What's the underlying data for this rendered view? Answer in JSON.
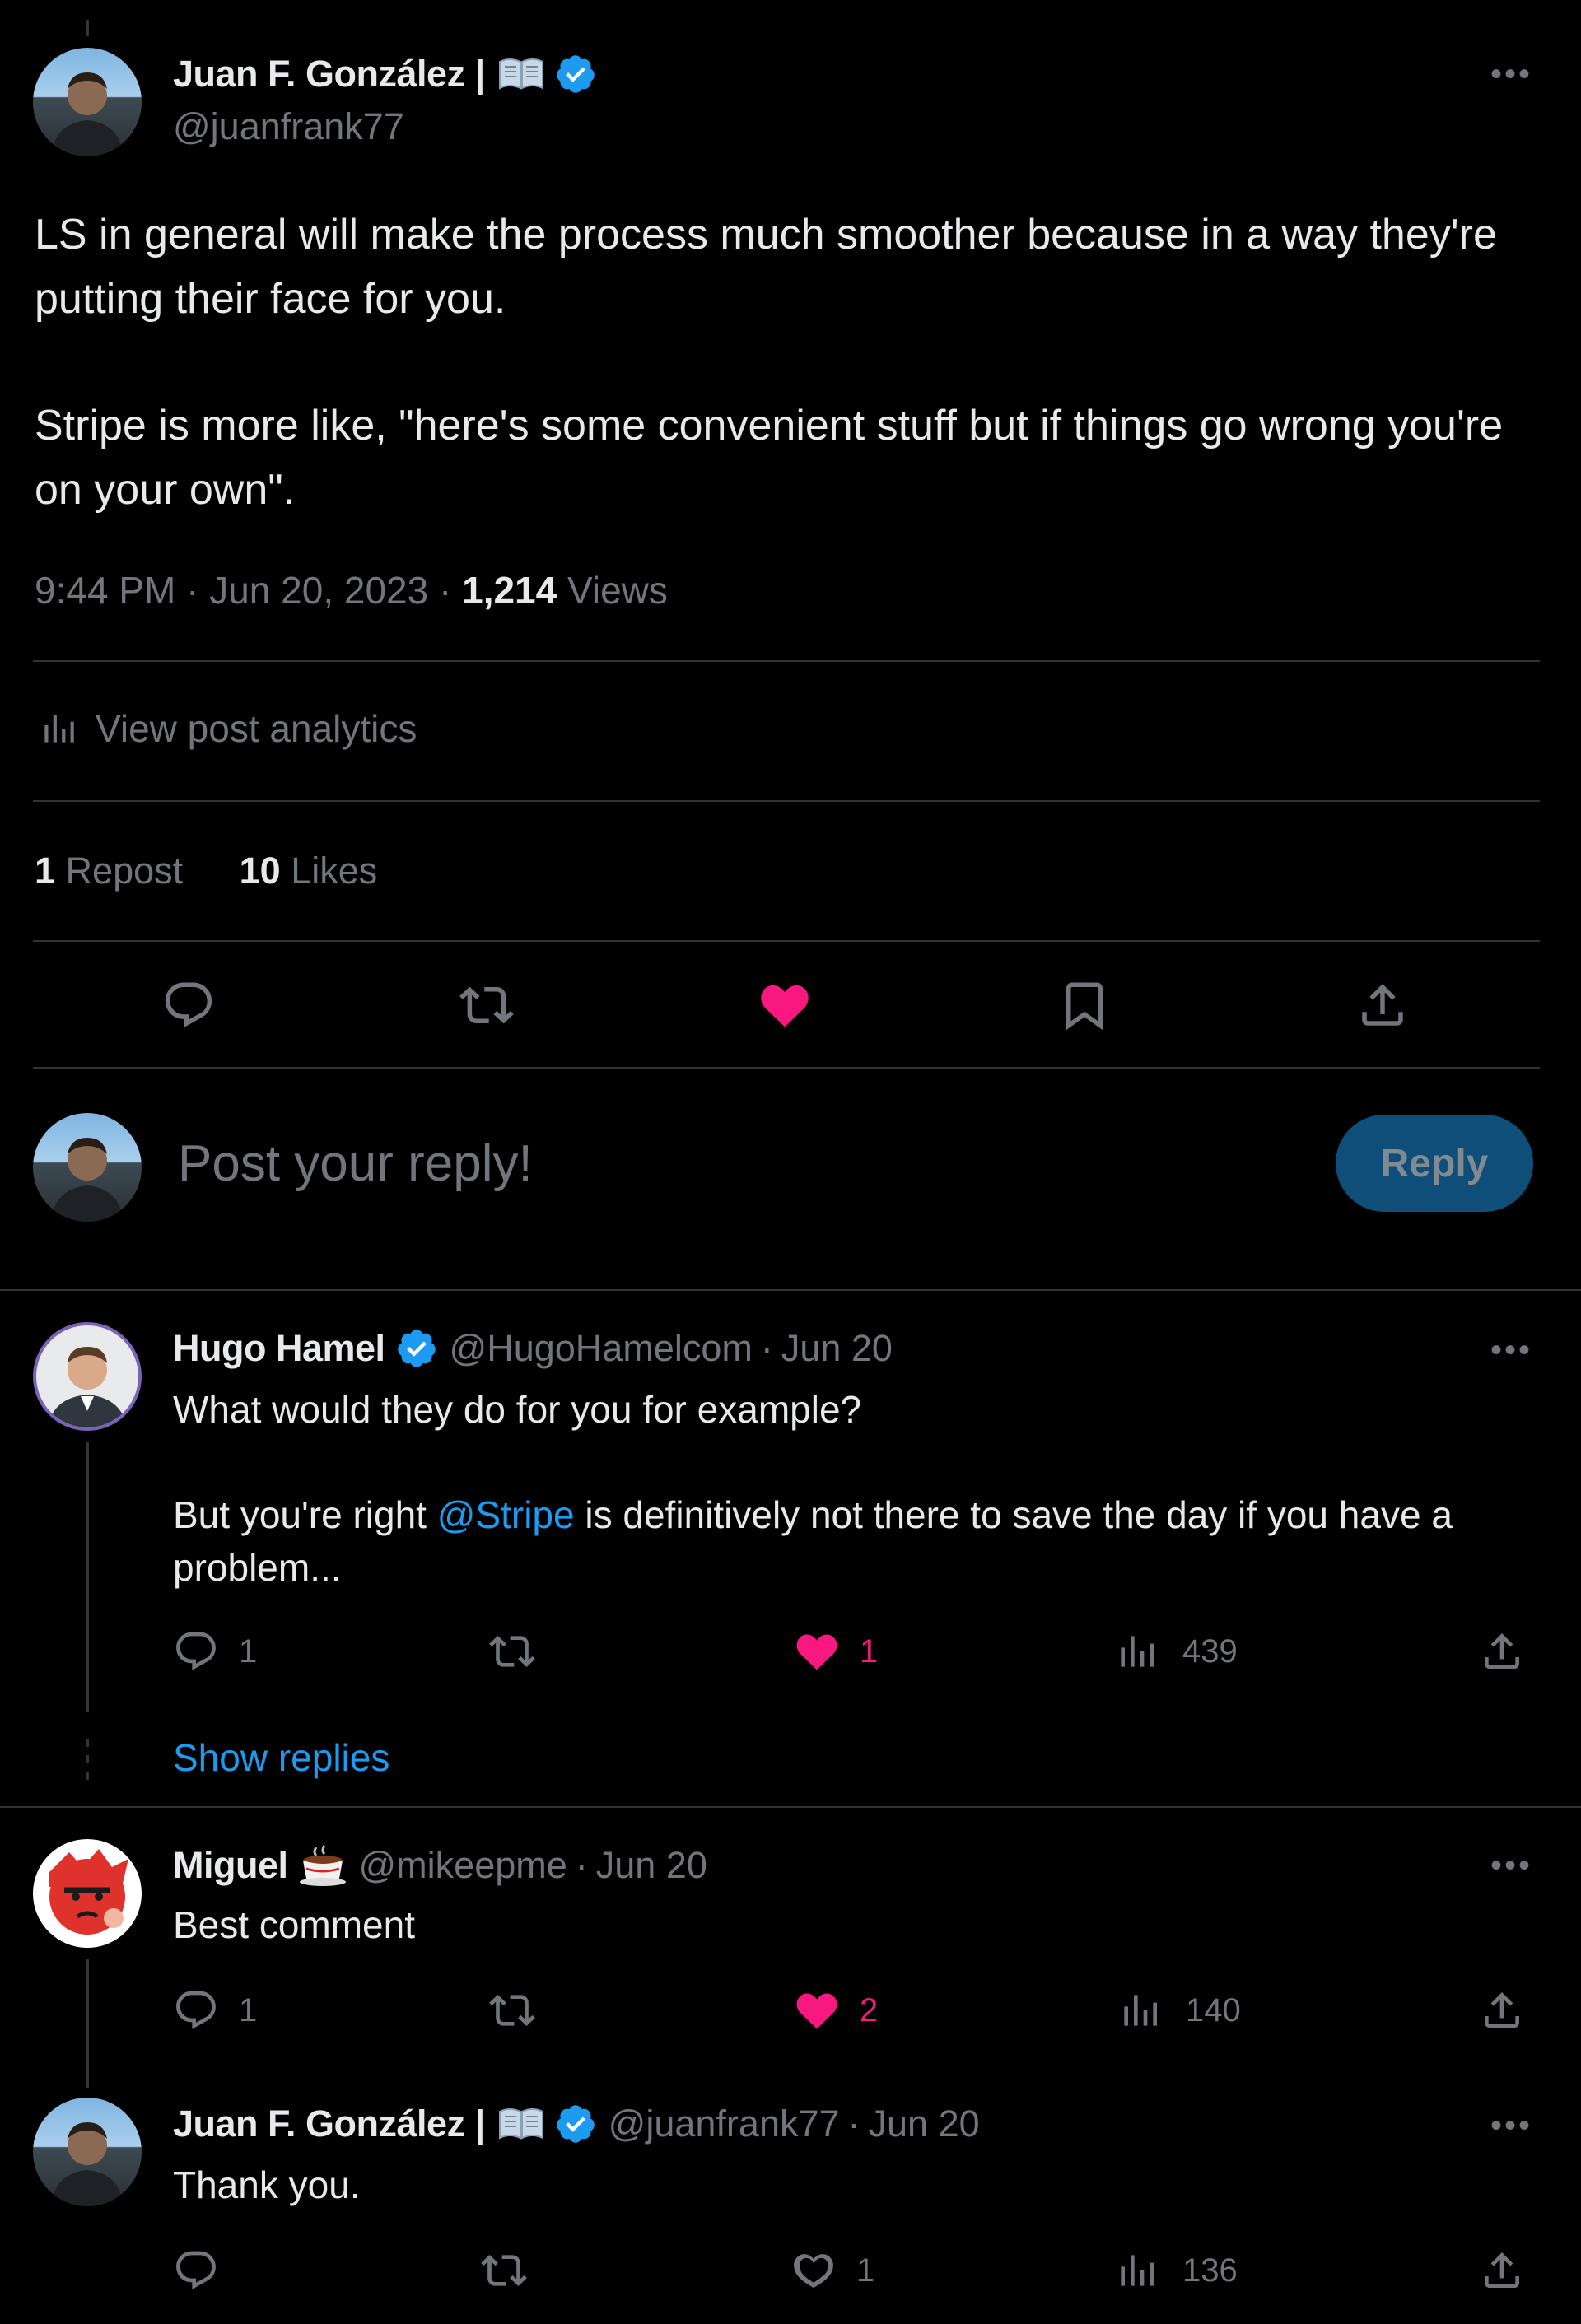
{
  "main_post": {
    "author_name": "Juan F. González |",
    "author_handle": "@juanfrank77",
    "text_p1": "LS in general will make the process much smoother because in a way they're putting their face for you.",
    "text_p2": "Stripe is more like, \"here's some convenient stuff but if things go wrong you're on your own\".",
    "time": "9:44 PM",
    "date": "Jun 20, 2023",
    "views_count": "1,214",
    "views_label": "Views",
    "analytics_label": "View post analytics",
    "reposts_count": "1",
    "reposts_label": "Repost",
    "likes_count": "10",
    "likes_label": "Likes"
  },
  "reply_box": {
    "placeholder": "Post your reply!",
    "button_label": "Reply"
  },
  "replies": [
    {
      "author_name": "Hugo Hamel",
      "author_handle": "@HugoHamelcom",
      "date": "Jun 20",
      "text_p1": "What would they do for you for example?",
      "text_p2_before": "But you're right ",
      "text_p2_mention": "@Stripe",
      "text_p2_after": " is definitively not there to save the day if you have a problem...",
      "reply_count": "1",
      "like_count": "1",
      "view_count": "439",
      "show_replies": "Show replies"
    },
    {
      "author_name": "Miguel",
      "author_handle": "@mikeepme",
      "date": "Jun 20",
      "text": "Best comment",
      "reply_count": "1",
      "like_count": "2",
      "view_count": "140"
    },
    {
      "author_name": "Juan F. González |",
      "author_handle": "@juanfrank77",
      "date": "Jun 20",
      "text": "Thank you.",
      "like_count": "1",
      "view_count": "136"
    }
  ],
  "separator": "·",
  "colors": {
    "background": "#000000",
    "text": "#e7e9ea",
    "muted": "#71767b",
    "divider": "#2f3336",
    "accent_blue": "#1d9bf0",
    "like_pink": "#f91880",
    "reply_button_bg": "#0f4e78",
    "verified": "#1d9bf0"
  },
  "icons": [
    "more-icon",
    "verified-badge-icon",
    "book-emoji-icon",
    "analytics-icon",
    "reply-icon",
    "repost-icon",
    "like-icon",
    "bookmark-icon",
    "share-icon",
    "views-icon",
    "coffee-emoji-icon"
  ]
}
